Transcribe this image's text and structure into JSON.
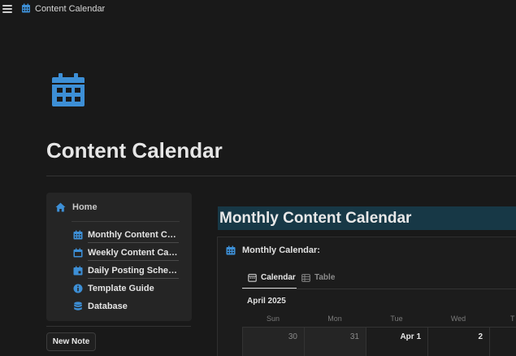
{
  "topbar": {
    "title": "Content Calendar",
    "menu_icon": "hamburger-menu-icon",
    "page_icon": "calendar-icon"
  },
  "page": {
    "title": "Content Calendar",
    "icon": "calendar-icon",
    "icon_color": "#3d8fd6"
  },
  "nav": {
    "home_label": "Home",
    "home_icon": "house-icon",
    "items": [
      {
        "label": "Monthly Content Calendar",
        "icon": "calendar-icon"
      },
      {
        "label": "Weekly Content Calendar",
        "icon": "calendar-icon"
      },
      {
        "label": "Daily Posting Schedule",
        "icon": "calendar-icon"
      },
      {
        "label": "Template Guide",
        "icon": "info-icon"
      },
      {
        "label": "Database",
        "icon": "database-icon"
      }
    ],
    "new_note_label": "New Note"
  },
  "section": {
    "heading": "Monthly Content Calendar",
    "heading_bg": "#173846"
  },
  "calendar": {
    "label": "Monthly Calendar:",
    "tabs": [
      {
        "label": "Calendar",
        "icon": "calendar-view-icon",
        "active": true
      },
      {
        "label": "Table",
        "icon": "table-icon",
        "active": false
      }
    ],
    "month": "April 2025",
    "weekdays": [
      "Sun",
      "Mon",
      "Tue",
      "Wed",
      "T"
    ],
    "first_row": [
      "",
      "30",
      "31",
      "Apr 1",
      "2"
    ]
  },
  "colors": {
    "background": "#191919",
    "accent_blue": "#3d8fd6"
  }
}
